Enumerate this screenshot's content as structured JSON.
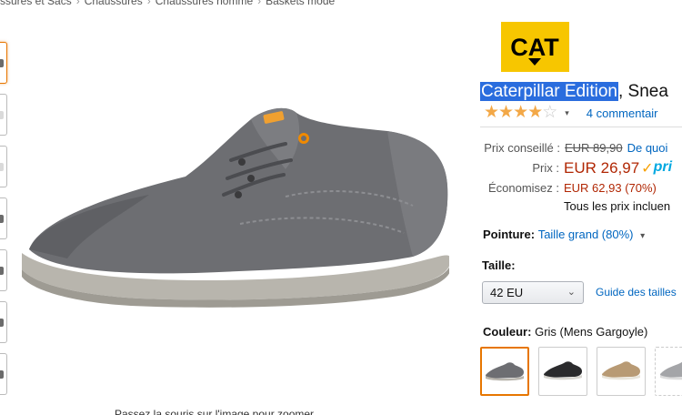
{
  "breadcrumb": {
    "items": [
      "ssures et Sacs",
      "Chaussures",
      "Chaussures homme",
      "Baskets mode"
    ],
    "separator": "›"
  },
  "gallery": {
    "zoom_hint": "Passez la souris sur l'image pour zoomer"
  },
  "product": {
    "brand_logo_text": "CAT",
    "title_highlighted": "Caterpillar Edition",
    "title_rest": ", Snea",
    "rating": {
      "stars": 4,
      "out_of": 5,
      "caret": "▾",
      "reviews_text": "4 commentair"
    }
  },
  "pricing": {
    "list_price_label": "Prix conseillé :",
    "list_price": "EUR 89,90",
    "list_price_link": "De quoi",
    "price_label": "Prix :",
    "price": "EUR 26,97",
    "prime_check": "✓",
    "prime_text": "pri",
    "savings_label": "Économisez :",
    "savings": "EUR 62,93 (70%)",
    "tax_note": "Tous les prix incluen"
  },
  "fit": {
    "label": "Pointure:",
    "value": "Taille grand (80%)",
    "caret": "▾"
  },
  "size": {
    "label": "Taille:",
    "selected": "42 EU",
    "chevron": "⌄",
    "guide_link": "Guide des tailles"
  },
  "color": {
    "label": "Couleur:",
    "value": "Gris (Mens Gargoyle)",
    "swatches": [
      "gris",
      "noir",
      "beige",
      "gris clair"
    ]
  },
  "colors": {
    "accent_orange": "#e77600",
    "price_red": "#b12704",
    "link_blue": "#0066c0",
    "star_gold": "#f3a847",
    "logo_yellow": "#f7c600",
    "selection_blue": "#2a6dde"
  }
}
